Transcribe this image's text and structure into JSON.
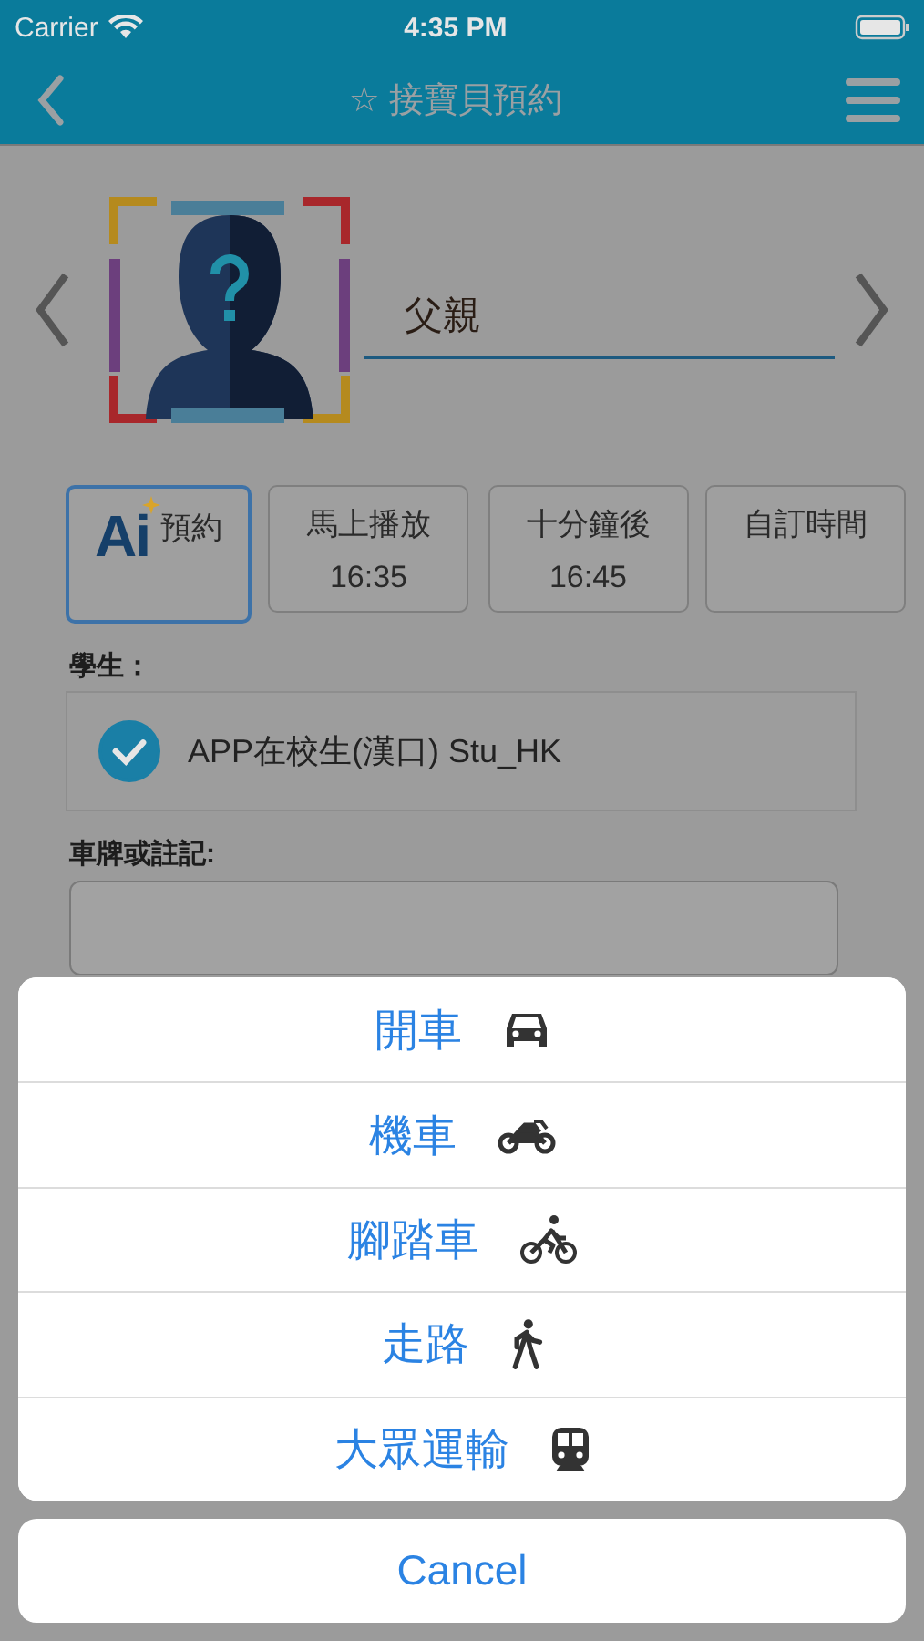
{
  "status_bar": {
    "carrier": "Carrier",
    "time": "4:35 PM"
  },
  "nav_bar": {
    "title": "☆ 接寶貝預約"
  },
  "profile": {
    "name": "父親"
  },
  "time_options": [
    {
      "kind": "ai",
      "logo": "Ai",
      "label": "預約",
      "selected": true
    },
    {
      "kind": "time",
      "label": "馬上播放",
      "time": "16:35",
      "selected": false
    },
    {
      "kind": "time",
      "label": "十分鐘後",
      "time": "16:45",
      "selected": false
    },
    {
      "kind": "custom",
      "label": "自訂時間",
      "selected": false
    }
  ],
  "students": {
    "label": "學生：",
    "items": [
      {
        "name": "APP在校生(漢口) Stu_HK",
        "checked": true
      }
    ]
  },
  "note": {
    "label": "車牌或註記:"
  },
  "action_sheet": {
    "options": [
      {
        "label": "開車",
        "kind": "car"
      },
      {
        "label": "機車",
        "kind": "motorcycle"
      },
      {
        "label": "腳踏車",
        "kind": "bicycle"
      },
      {
        "label": "走路",
        "kind": "walk"
      },
      {
        "label": "大眾運輸",
        "kind": "train"
      }
    ],
    "cancel": "Cancel"
  }
}
